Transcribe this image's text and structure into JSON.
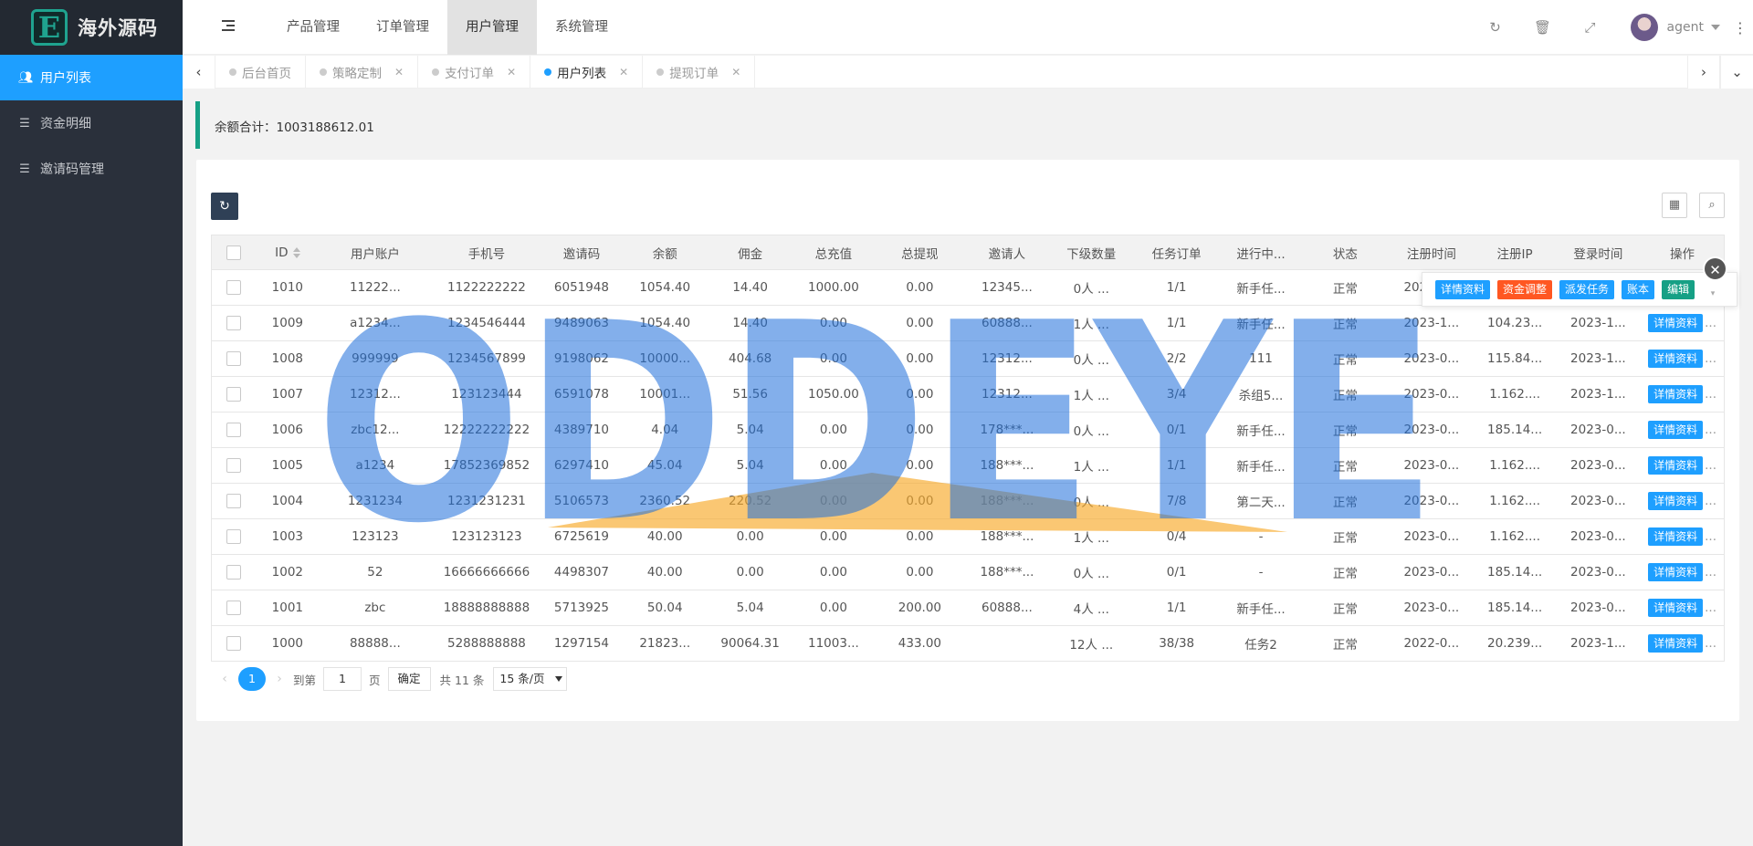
{
  "logo": {
    "mark": "E",
    "text": "海外源码"
  },
  "sidebar": {
    "items": [
      {
        "label": "用户列表",
        "icon": "users-icon",
        "active": true
      },
      {
        "label": "资金明细",
        "icon": "list-icon",
        "active": false
      },
      {
        "label": "邀请码管理",
        "icon": "list-icon",
        "active": false
      }
    ]
  },
  "header": {
    "menu": [
      {
        "label": "产品管理",
        "active": false
      },
      {
        "label": "订单管理",
        "active": false
      },
      {
        "label": "用户管理",
        "active": true
      },
      {
        "label": "系统管理",
        "active": false
      }
    ],
    "username": "agent"
  },
  "tabs": [
    {
      "label": "后台首页",
      "closable": false,
      "active": false
    },
    {
      "label": "策略定制",
      "closable": true,
      "active": false
    },
    {
      "label": "支付订单",
      "closable": true,
      "active": false
    },
    {
      "label": "用户列表",
      "closable": true,
      "active": true
    },
    {
      "label": "提现订单",
      "closable": true,
      "active": false
    }
  ],
  "notice": {
    "text": "余额合计：1003188612.01"
  },
  "table": {
    "columns": [
      "ID",
      "用户账户",
      "手机号",
      "邀请码",
      "余额",
      "佣金",
      "总充值",
      "总提现",
      "邀请人",
      "下级数量",
      "任务订单",
      "进行中...",
      "状态",
      "注册时间",
      "注册IP",
      "登录时间",
      "操作"
    ],
    "rows": [
      [
        "1010",
        "11222...",
        "1122222222",
        "6051948",
        "1054.40",
        "14.40",
        "1000.00",
        "0.00",
        "12345...",
        "0人 ...",
        "1/1",
        "新手任...",
        "正常",
        "2023-1...",
        "",
        "",
        ""
      ],
      [
        "1009",
        "a1234...",
        "1234546444",
        "9489063",
        "1054.40",
        "14.40",
        "0.00",
        "0.00",
        "60888...",
        "1人 ...",
        "1/1",
        "新手任...",
        "正常",
        "2023-1...",
        "104.23...",
        "2023-1...",
        "详情资料"
      ],
      [
        "1008",
        "999999",
        "1234567899",
        "9198062",
        "10000...",
        "404.68",
        "0.00",
        "0.00",
        "12312...",
        "0人 ...",
        "2/2",
        "111",
        "正常",
        "2023-0...",
        "115.84...",
        "2023-1...",
        "详情资料"
      ],
      [
        "1007",
        "12312...",
        "123123444",
        "6591078",
        "10001...",
        "51.56",
        "1050.00",
        "0.00",
        "12312...",
        "1人 ...",
        "3/4",
        "杀组5...",
        "正常",
        "2023-0...",
        "1.162....",
        "2023-1...",
        "详情资料"
      ],
      [
        "1006",
        "zbc12...",
        "12222222222",
        "4389710",
        "4.04",
        "5.04",
        "0.00",
        "0.00",
        "178***...",
        "0人 ...",
        "0/1",
        "新手任...",
        "正常",
        "2023-0...",
        "185.14...",
        "2023-0...",
        "详情资料"
      ],
      [
        "1005",
        "a1234",
        "17852369852",
        "6297410",
        "45.04",
        "5.04",
        "0.00",
        "0.00",
        "188***...",
        "1人 ...",
        "1/1",
        "新手任...",
        "正常",
        "2023-0...",
        "1.162....",
        "2023-0...",
        "详情资料"
      ],
      [
        "1004",
        "1231234",
        "1231231231",
        "5106573",
        "2360.52",
        "220.52",
        "0.00",
        "0.00",
        "188***...",
        "0人 ...",
        "7/8",
        "第二天...",
        "正常",
        "2023-0...",
        "1.162....",
        "2023-0...",
        "详情资料"
      ],
      [
        "1003",
        "123123",
        "123123123",
        "6725619",
        "40.00",
        "0.00",
        "0.00",
        "0.00",
        "188***...",
        "1人 ...",
        "0/4",
        "-",
        "正常",
        "2023-0...",
        "1.162....",
        "2023-0...",
        "详情资料"
      ],
      [
        "1002",
        "52",
        "16666666666",
        "4498307",
        "40.00",
        "0.00",
        "0.00",
        "0.00",
        "188***...",
        "0人 ...",
        "0/1",
        "-",
        "正常",
        "2023-0...",
        "185.14...",
        "2023-0...",
        "详情资料"
      ],
      [
        "1001",
        "zbc",
        "18888888888",
        "5713925",
        "50.04",
        "5.04",
        "0.00",
        "200.00",
        "60888...",
        "4人 ...",
        "1/1",
        "新手任...",
        "正常",
        "2023-0...",
        "185.14...",
        "2023-0...",
        "详情资料"
      ],
      [
        "1000",
        "88888...",
        "5288888888",
        "1297154",
        "21823...",
        "90064.31",
        "11003...",
        "433.00",
        "",
        "12人 ...",
        "38/38",
        "任务2",
        "正常",
        "2022-0...",
        "20.239...",
        "2023-1...",
        "详情资料"
      ]
    ]
  },
  "popup": {
    "buttons": [
      {
        "label": "详情资料",
        "color": "#1e9fff"
      },
      {
        "label": "资金调整",
        "color": "#ff5722"
      },
      {
        "label": "派发任务",
        "color": "#1e9fff"
      },
      {
        "label": "账本",
        "color": "#1e9fff"
      },
      {
        "label": "编辑",
        "color": "#16a085"
      }
    ]
  },
  "pager": {
    "current": "1",
    "goto_label": "到第",
    "goto_value": "1",
    "page_suffix": "页",
    "confirm": "确定",
    "total": "共 11 条",
    "per_page": "15 条/页"
  },
  "watermark": {
    "text": "ODDEYE",
    "color": "#1e6fdc",
    "accent": "#f7a928"
  },
  "colors": {
    "primary": "#1e9fff",
    "sidebar": "#2a303b",
    "accent_green": "#16a085",
    "danger": "#ff5722"
  }
}
